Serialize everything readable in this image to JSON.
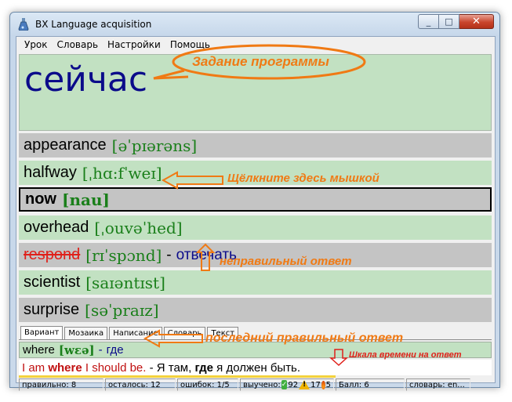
{
  "window": {
    "title": "BX Language acquisition",
    "close_glyph": "✕",
    "min_glyph": "_",
    "max_glyph": "□"
  },
  "menu": [
    "Урок",
    "Словарь",
    "Настройки",
    "Помощь"
  ],
  "task": {
    "word": "сейчас"
  },
  "options": [
    {
      "word": "appearance",
      "transcription": "[əˈpɪərəns]",
      "state": "normal",
      "bg": "gray"
    },
    {
      "word": "halfway",
      "transcription": "[ˌhɑ:fˈweɪ]",
      "state": "normal",
      "bg": "green"
    },
    {
      "word": "now",
      "transcription": "[nau]",
      "state": "selected",
      "bg": "gray"
    },
    {
      "word": "overhead",
      "transcription": "[ˌouvəˈhed]",
      "state": "normal",
      "bg": "green"
    },
    {
      "word": "respond",
      "transcription": "[rɪˈspɔnd]",
      "state": "wrong",
      "bg": "gray",
      "dash": "-",
      "translation": "отвечать"
    },
    {
      "word": "scientist",
      "transcription": "[saɪəntɪst]",
      "state": "normal",
      "bg": "green"
    },
    {
      "word": "surprise",
      "transcription": "[səˈpraɪz]",
      "state": "normal",
      "bg": "gray"
    }
  ],
  "tabs": [
    {
      "label": "Вариант",
      "active": true
    },
    {
      "label": "Мозаика",
      "active": false
    },
    {
      "label": "Написание",
      "active": false
    },
    {
      "label": "Словарь",
      "active": false
    },
    {
      "label": "Текст",
      "active": false
    }
  ],
  "last_answer": {
    "word": "where",
    "transcription": "[wɛə]",
    "dash": "-",
    "translation": "где"
  },
  "example": {
    "en_1": "I am ",
    "en_bold": "where",
    "en_2": " I should be.",
    "ru_dash": " - Я там, ",
    "ru_bold": "где",
    "ru_2": " я должен быть."
  },
  "time_scale": {
    "fraction": 0.67
  },
  "status": {
    "correct": "правильно: 8",
    "remaining": "осталось: 12",
    "errors": "ошибок: 1/5",
    "learned_label": "выучено:",
    "learned_ok": "92",
    "learned_warn": "17",
    "learned_fire": "5",
    "score": "Балл: 6",
    "dictionary": "словарь: en..."
  },
  "annotations": {
    "task": "Задание программы",
    "click": "Щёлкните здесь мышкой",
    "wrong": "неправильный ответ",
    "last": "последний правильный ответ",
    "timescale": "Шкала времени на ответ"
  },
  "colors": {
    "accent_annotation": "#f07a14",
    "row_green": "#c2e1c2",
    "row_gray": "#c4c4c4",
    "task_word": "#0b0b8a",
    "transcription": "#1a7f1a",
    "wrong": "#e0201a"
  }
}
